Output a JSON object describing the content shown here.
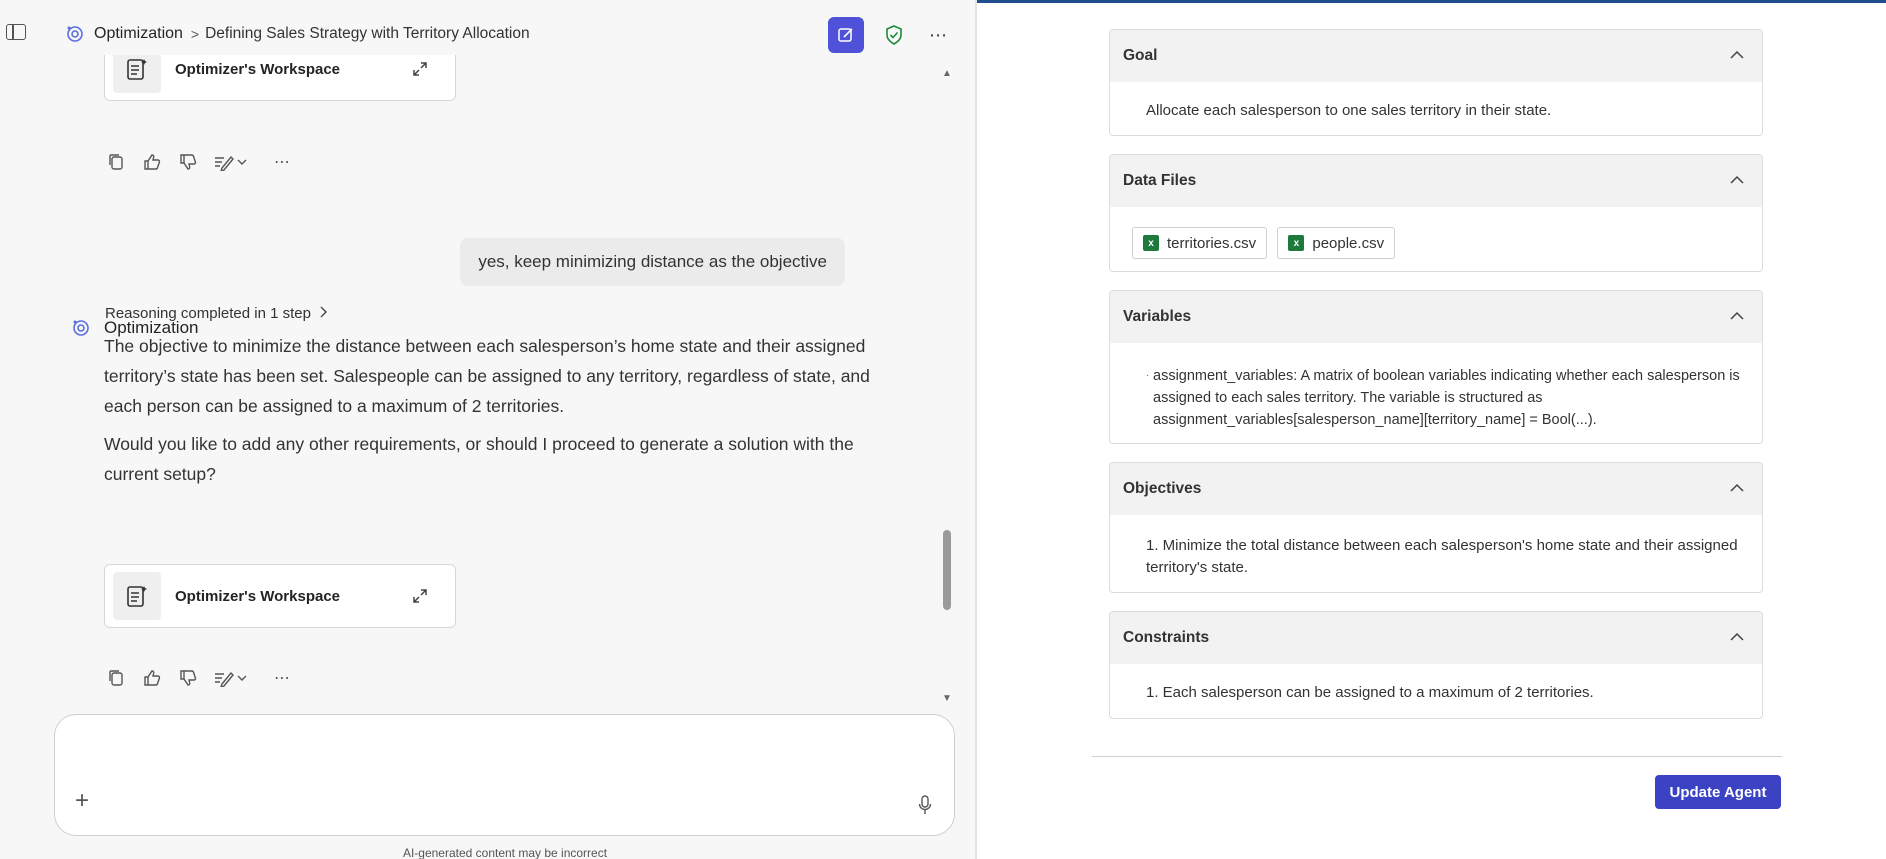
{
  "header": {
    "app_name": "Optimization",
    "separator": ">",
    "conversation_title": "Defining Sales Strategy with Territory Allocation"
  },
  "chat": {
    "workspace_card_label": "Optimizer's Workspace",
    "user_message": "yes, keep minimizing distance as the objective",
    "bot_name": "Optimization",
    "reasoning": "Reasoning completed in 1 step",
    "bot_paragraph_1": "The objective to minimize the distance between each salesperson’s home state and their assigned territory’s state has been set. Salespeople can be assigned to any territory, regardless of state, and each person can be assigned to a maximum of 2 territories.",
    "bot_paragraph_2": "Would you like to add any other requirements, or should I proceed to generate a solution with the current setup?",
    "composer_placeholder": "",
    "disclaimer": "AI-generated content may be incorrect"
  },
  "panel": {
    "goal": {
      "title": "Goal",
      "text": "Allocate each salesperson to one sales territory in their state."
    },
    "data_files": {
      "title": "Data Files",
      "files": [
        "territories.csv",
        "people.csv"
      ]
    },
    "variables": {
      "title": "Variables",
      "text": "assignment_variables: A matrix of boolean variables indicating whether each salesperson is assigned to each sales territory. The variable is structured as assignment_variables[salesperson_name][territory_name] = Bool(...)."
    },
    "objectives": {
      "title": "Objectives",
      "text": "1. Minimize the total distance between each salesperson's home state and their assigned territory's state."
    },
    "constraints": {
      "title": "Constraints",
      "text": "1. Each salesperson can be assigned to a maximum of 2 territories."
    },
    "update_button": "Update Agent"
  },
  "colors": {
    "accent": "#4f52d8",
    "update_button": "#3b43c4",
    "excel_green": "#1e7a3c",
    "shield_green": "#1a8a3a"
  }
}
